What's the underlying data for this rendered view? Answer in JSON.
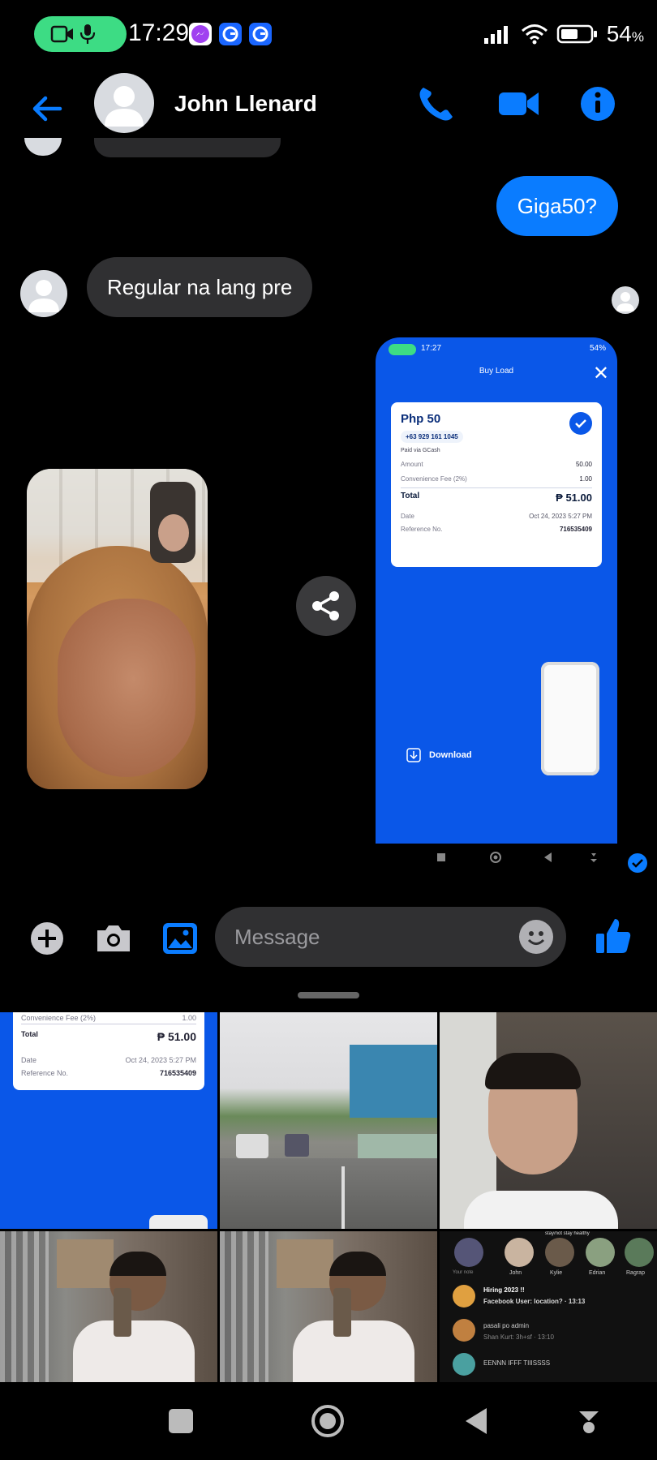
{
  "status_bar": {
    "time": "17:29",
    "battery": "54",
    "battery_unit": "%"
  },
  "header": {
    "contact_name": "John Llenard"
  },
  "messages": {
    "outgoing_1": "Giga50?",
    "incoming_1": "Regular na lang pre"
  },
  "gcash_receipt": {
    "status_time": "17:27",
    "status_battery": "54",
    "title": "Buy Load",
    "amount_title": "Php 50",
    "phone": "+63 929 161 1045",
    "paid_via": "Paid via GCash",
    "amount_label": "Amount",
    "amount_value": "50.00",
    "fee_label": "Convenience Fee (2%)",
    "fee_value": "1.00",
    "total_label": "Total",
    "total_value": "₱ 51.00",
    "date_label": "Date",
    "date_value": "Oct 24, 2023 5:27 PM",
    "ref_label": "Reference No.",
    "ref_value": "716535409",
    "download_label": "Download"
  },
  "composer": {
    "placeholder": "Message"
  },
  "gallery": {
    "receipt_tile": {
      "fee_label": "Convenience Fee (2%)",
      "fee_value": "1.00",
      "total_label": "Total",
      "total_value": "₱ 51.00",
      "date_label": "Date",
      "date_value": "Oct 24, 2023 5:27 PM",
      "ref_label": "Reference No.",
      "ref_value": "716535409"
    },
    "fb_tile": {
      "stories": [
        "Your note",
        "John",
        "Kylie",
        "Edrian",
        "Ragrap"
      ],
      "note_bubble": "stay/not stay healthy",
      "chat_1_title": "Hiring 2023 !!",
      "chat_1_preview": "Facebook User: location? · 13:13",
      "chat_2_title": "pasali po admin",
      "chat_2_preview": "Shan Kurt: 3h+sf · 13:10",
      "chat_3_title": "EENNN IFFF TIIISSSS"
    }
  },
  "colors": {
    "messenger_blue": "#0a7cff",
    "gcash_blue": "#0a57e8",
    "bubble_gray": "#303032",
    "status_pill_green": "#3ddc84"
  }
}
